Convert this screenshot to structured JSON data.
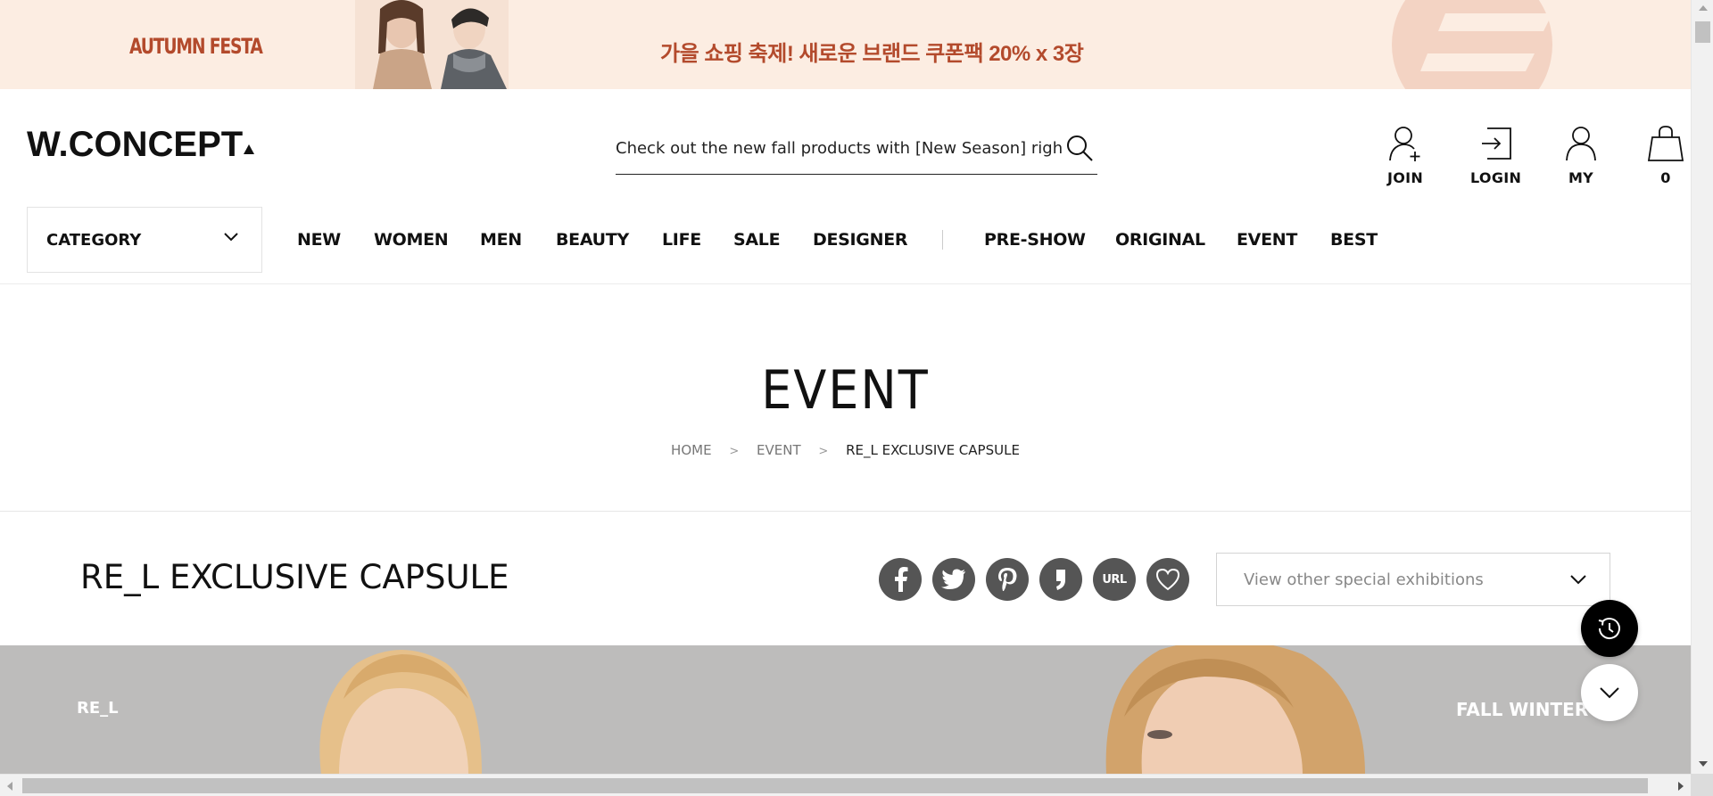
{
  "banner": {
    "left_text": "AUTUMN FESTA",
    "center_text": "가을 쇼핑 축제! 새로운 브랜드 쿠폰팩 20% x 3장",
    "color": "#b34a2c",
    "background": "#fcede2"
  },
  "header": {
    "logo": "W.CONCEPT",
    "search_placeholder": "Check out the new fall products with [New Season] right now!",
    "utils": [
      {
        "label": "JOIN",
        "icon": "user-plus-icon"
      },
      {
        "label": "LOGIN",
        "icon": "login-icon"
      },
      {
        "label": "MY",
        "icon": "user-icon"
      },
      {
        "label": "0",
        "icon": "shopping-bag-icon"
      }
    ]
  },
  "nav": {
    "category_label": "CATEGORY",
    "items": [
      "NEW",
      "WOMEN",
      "MEN",
      "BEAUTY",
      "LIFE",
      "SALE",
      "DESIGNER"
    ],
    "items_right": [
      "PRE-SHOW",
      "ORIGINAL",
      "EVENT",
      "BEST"
    ]
  },
  "page": {
    "title": "EVENT",
    "breadcrumb": [
      "HOME",
      "EVENT",
      "RE_L EXCLUSIVE CAPSULE"
    ]
  },
  "exhibition": {
    "title": "RE_L EXCLUSIVE CAPSULE",
    "share_icons": [
      "facebook-icon",
      "twitter-icon",
      "pinterest-icon",
      "kakao-story-icon",
      "url-icon",
      "heart-icon"
    ],
    "url_label": "URL",
    "select_label": "View other special exhibitions"
  },
  "hero": {
    "left_text": "RE_L",
    "right_text": "FALL WINTER"
  }
}
